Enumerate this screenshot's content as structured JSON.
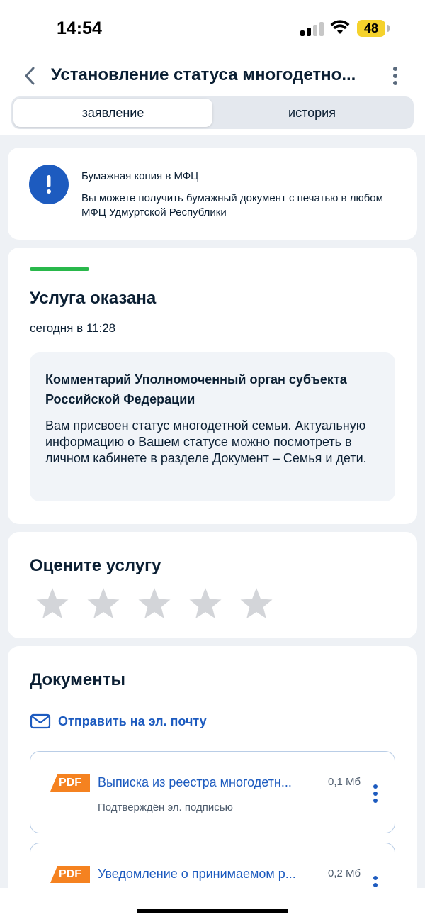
{
  "status_bar": {
    "time": "14:54",
    "battery": "48",
    "battery_color": "#f5d22c",
    "icons": [
      "cellular-signal-icon",
      "wifi-icon",
      "battery-icon"
    ]
  },
  "header": {
    "title": "Установление статуса многодетно...",
    "back_icon": "chevron-left-icon",
    "menu_icon": "more-vertical-icon"
  },
  "tabs": [
    {
      "label": "заявление",
      "active": true
    },
    {
      "label": "история",
      "active": false
    }
  ],
  "info_card": {
    "icon": "exclamation-icon",
    "title": "Бумажная копия в МФЦ",
    "text": "Вы можете получить бумажный документ с печатью в любом МФЦ Удмуртской Республики"
  },
  "status_card": {
    "progress_color": "#29b84b",
    "title": "Услуга оказана",
    "date": "сегодня в 11:28",
    "comment_title": "Комментарий Уполномоченный орган субъекта Российской Федерации",
    "comment_text": "Вам присвоен статус многодетной семьи. Актуальную информацию о Вашем статусе можно посмотреть в личном кабинете в разделе Документ – Семья и дети."
  },
  "rating_card": {
    "title": "Оцените услугу",
    "max_stars": 5,
    "selected": 0
  },
  "documents_card": {
    "title": "Документы",
    "send_email_label": "Отправить на эл. почту",
    "send_email_icon": "mail-icon",
    "documents": [
      {
        "badge": "PDF",
        "name": "Выписка из реестра многодетн...",
        "size": "0,1 Мб",
        "note": "Подтверждён эл. подписью"
      },
      {
        "badge": "PDF",
        "name": "Уведомление о принимаемом р...",
        "size": "0,2 Мб",
        "note": ""
      }
    ]
  },
  "colors": {
    "accent_blue": "#1d5bbf",
    "pdf_orange": "#f58220",
    "background": "#eef1f5"
  }
}
